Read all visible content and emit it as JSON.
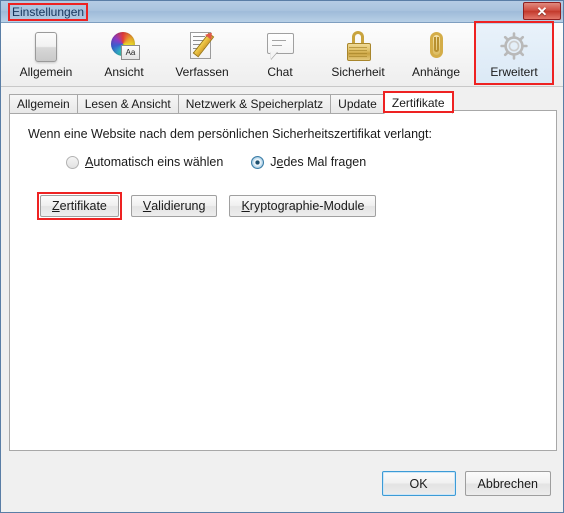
{
  "window": {
    "title": "Einstellungen",
    "close_label": "✕"
  },
  "toolbar": {
    "items": [
      {
        "label": "Allgemein",
        "icon": "window-toggle-icon",
        "selected": false
      },
      {
        "label": "Ansicht",
        "icon": "color-wheel-icon",
        "selected": false
      },
      {
        "label": "Verfassen",
        "icon": "compose-pencil-icon",
        "selected": false
      },
      {
        "label": "Chat",
        "icon": "chat-bubble-icon",
        "selected": false
      },
      {
        "label": "Sicherheit",
        "icon": "padlock-icon",
        "selected": false
      },
      {
        "label": "Anhänge",
        "icon": "paperclip-icon",
        "selected": false
      },
      {
        "label": "Erweitert",
        "icon": "gear-icon",
        "selected": true
      }
    ]
  },
  "tabs": [
    {
      "label": "Allgemein",
      "selected": false
    },
    {
      "label": "Lesen & Ansicht",
      "selected": false
    },
    {
      "label": "Netzwerk & Speicherplatz",
      "selected": false
    },
    {
      "label": "Update",
      "selected": false
    },
    {
      "label": "Zertifikate",
      "selected": true
    }
  ],
  "content": {
    "prompt": "Wenn eine Website nach dem persönlichen Sicherheitszertifikat verlangt:",
    "radios": [
      {
        "label_pre": "",
        "label_accel": "A",
        "label_post": "utomatisch eins wählen",
        "selected": false
      },
      {
        "label_pre": "J",
        "label_accel": "e",
        "label_post": "des Mal fragen",
        "selected": true
      }
    ],
    "buttons": [
      {
        "label_accel": "Z",
        "label_post": "ertifikate",
        "highlighted": true
      },
      {
        "label_accel": "V",
        "label_post": "alidierung",
        "highlighted": false
      },
      {
        "label_accel": "K",
        "label_post": "ryptographie-Module",
        "highlighted": false
      }
    ]
  },
  "footer": {
    "ok_label": "OK",
    "cancel_label": "Abbrechen"
  },
  "colors": {
    "highlight_red": "#ee2222",
    "titlebar_blue": "#a9c3de",
    "selected_tool_bg": "#dbe9f6",
    "focus_blue": "#3c9bd6"
  }
}
